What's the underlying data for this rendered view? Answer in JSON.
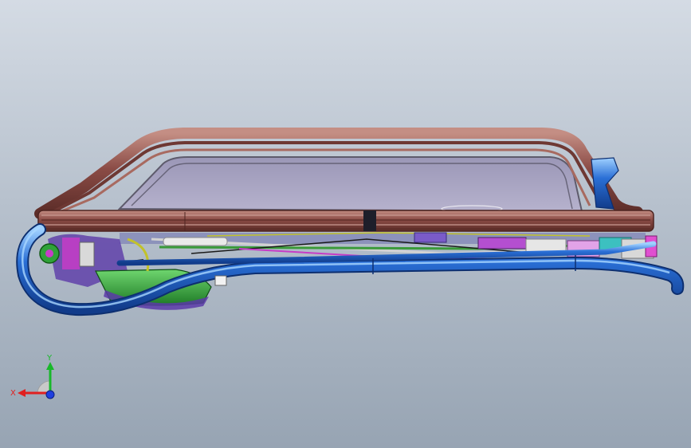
{
  "viewport": {
    "background_top": "#d4dbe4",
    "background_bottom": "#97a4b3",
    "model_name": "sunroof-assembly"
  },
  "colors": {
    "frame_brown": "#8a4b45",
    "frame_brown_light": "#b87a70",
    "glass": "#a7a3c4",
    "glass_edge": "#6d6b7d",
    "rail_blue": "#2a6fd6",
    "rail_blue_light": "#79b6f2",
    "mechanism_green": "#2fa238",
    "mechanism_magenta": "#c63cc7",
    "mechanism_purple": "#5b3aa8",
    "x_axis": "#e02020",
    "y_axis": "#18b82a",
    "z_axis": "#1f3fe0"
  },
  "triad": {
    "x_label": "X",
    "y_label": "Y",
    "x_icon": "x-axis-arrow-icon",
    "y_icon": "y-axis-arrow-icon",
    "z_icon": "z-axis-dot-icon"
  }
}
